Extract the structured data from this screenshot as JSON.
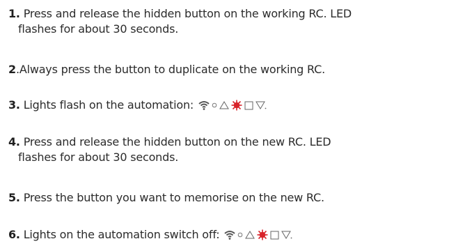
{
  "steps": [
    {
      "number": "1.",
      "line1": "Press and release the hidden button on the working RC. LED",
      "line2": "flashes for about 30 seconds."
    },
    {
      "number": "2",
      "text": ".Always press the button to duplicate on the working RC."
    },
    {
      "number": "3.",
      "text": "Lights flash on the automation:"
    },
    {
      "number": "4.",
      "line1": "Press and release the hidden button on the new RC. LED",
      "line2": "flashes for about 30 seconds."
    },
    {
      "number": "5.",
      "text": "Press the button you want to memorise on the new RC."
    },
    {
      "number": "6.",
      "text": "Lights on the automation switch off:"
    }
  ],
  "status_icons": [
    "wifi-icon",
    "circle-icon",
    "triangle-icon",
    "star-burst-icon",
    "square-icon",
    "down-triangle-icon"
  ],
  "colors": {
    "text": "#2b2b2b",
    "icon_gray": "#555555",
    "icon_red": "#d8232a"
  }
}
